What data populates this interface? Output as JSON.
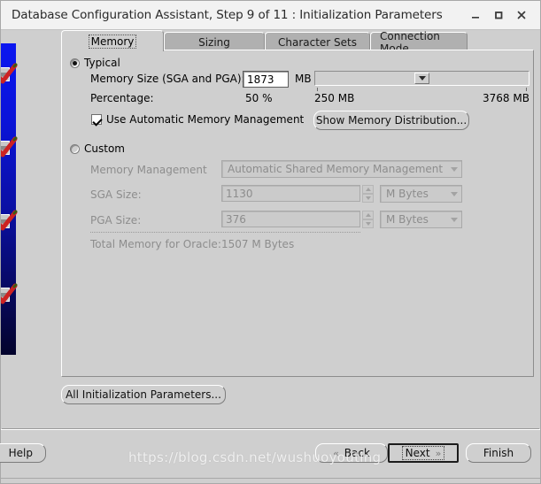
{
  "window": {
    "title": "Database Configuration Assistant, Step 9 of 11 : Initialization Parameters",
    "minimize_icon": "minimize-icon",
    "maximize_icon": "maximize-icon",
    "close_icon": "close-icon"
  },
  "tabs": [
    {
      "label": "Memory",
      "selected": true
    },
    {
      "label": "Sizing",
      "selected": false
    },
    {
      "label": "Character Sets",
      "selected": false
    },
    {
      "label": "Connection Mode",
      "selected": false
    }
  ],
  "typical": {
    "radio_label": "Typical",
    "selected": true,
    "memory_size_label": "Memory Size (SGA and PGA):",
    "memory_size_value": "1873",
    "memory_size_unit": "MB",
    "percentage_label": "Percentage:",
    "percentage_value": "50 %",
    "slider_min_label": "250 MB",
    "slider_max_label": "3768 MB",
    "slider_position_percent": 50,
    "amm_checkbox_label": "Use Automatic Memory Management",
    "amm_checked": true,
    "show_distribution_button": "Show Memory Distribution..."
  },
  "custom": {
    "radio_label": "Custom",
    "selected": false,
    "memory_management_label": "Memory Management",
    "memory_management_value": "Automatic Shared Memory Management",
    "sga_label": "SGA Size:",
    "sga_value": "1130",
    "sga_unit": "M Bytes",
    "pga_label": "PGA Size:",
    "pga_value": "376",
    "pga_unit": "M Bytes",
    "total_label": "Total Memory for Oracle:",
    "total_value": "1507 M Bytes"
  },
  "all_params_button": "All Initialization Parameters...",
  "footer": {
    "help": "Help",
    "back": "Back",
    "next": "Next",
    "finish": "Finish"
  },
  "watermark": "https://blog.csdn.net/wushuoyouting",
  "colors": {
    "window_bg": "#cfcfcf",
    "titlebar_bg": "#f2f2f2",
    "tab_inactive": "#b0b0b0",
    "progress_blue": "#0b16f0",
    "check_red": "#cc2222",
    "disabled_text": "#8d8d8d"
  }
}
